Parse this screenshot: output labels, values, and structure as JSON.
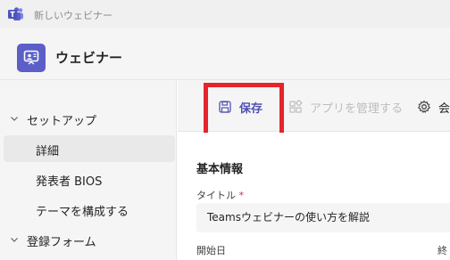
{
  "window": {
    "title": "新しいウェビナー"
  },
  "app": {
    "title": "ウェビナー"
  },
  "sidebar": {
    "groups": [
      {
        "label": "セットアップ",
        "items": [
          {
            "label": "詳細",
            "selected": true
          },
          {
            "label": "発表者 BIOS",
            "selected": false
          },
          {
            "label": "テーマを構成する",
            "selected": false
          }
        ]
      },
      {
        "label": "登録フォーム",
        "items": []
      }
    ]
  },
  "toolbar": {
    "save_label": "保存",
    "apps_label": "アプリを管理する",
    "settings_label": "会"
  },
  "form": {
    "section_title": "基本情報",
    "title_label": "タイトル",
    "required_mark": "*",
    "title_value": "Teamsウェビナーの使い方を解説",
    "start_label": "開始日",
    "end_label": "終"
  },
  "colors": {
    "accent": "#5b5fc7",
    "highlight_border": "#e6242c",
    "required": "#c4314b"
  },
  "icons": {
    "teams_logo": "teams-logo-icon",
    "app": "webinar-app-icon",
    "save": "save-icon",
    "apps": "apps-icon",
    "settings": "gear-icon",
    "chevron": "chevron-down-icon"
  }
}
